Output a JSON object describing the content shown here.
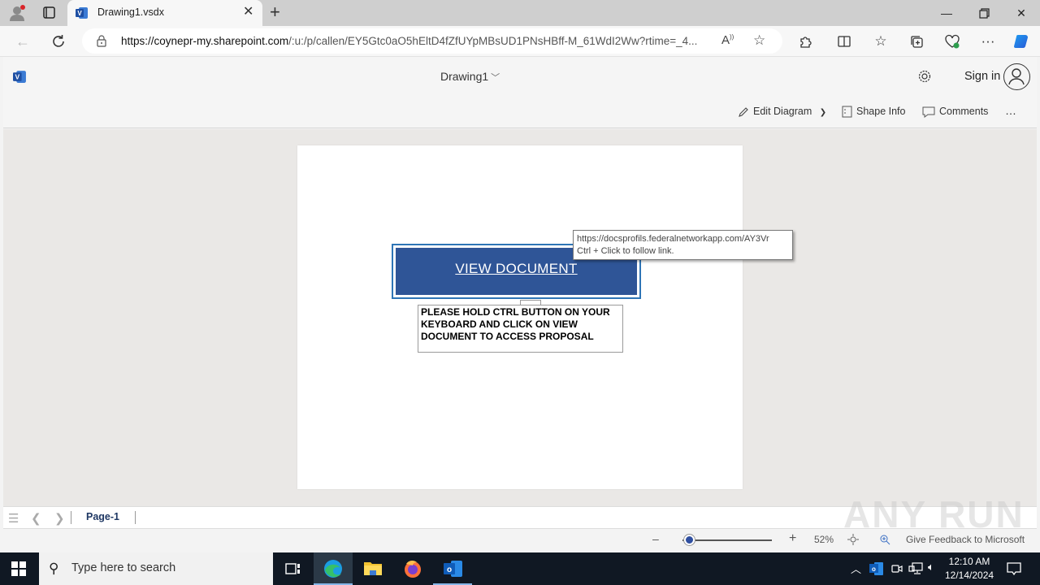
{
  "browser": {
    "tab_title": "Drawing1.vsdx",
    "new_tab_icon": "plus-icon",
    "url_domain": "https://coynepr-my.sharepoint.com",
    "url_rest": "/:u:/p/callen/EY5Gtc0aO5hEltD4fZfUYpMBsUD1PNsHBff-M_61WdI2Ww?rtime=_4...",
    "read_aloud_label": "A",
    "window_controls": [
      "minimize",
      "restore",
      "close"
    ]
  },
  "app": {
    "doc_title": "Drawing1",
    "sign_in": "Sign in",
    "commands": {
      "edit_diagram": "Edit Diagram",
      "shape_info": "Shape Info",
      "comments": "Comments",
      "more": "…"
    }
  },
  "canvas": {
    "view_document_label": "VIEW DOCUMENT",
    "instruction_text": "PLEASE HOLD CTRL BUTTON ON YOUR KEYBOARD AND CLICK ON VIEW DOCUMENT TO ACCESS PROPOSAL",
    "tooltip": {
      "url": "https://docsprofils.federalnetworkapp.com/AY3Vr",
      "hint": "Ctrl + Click to follow link."
    },
    "colors": {
      "button_fill": "#2f5597",
      "button_border": "#2e75b6"
    }
  },
  "pagebar": {
    "page_tab": "Page-1"
  },
  "statusbar": {
    "zoom_minus": "–",
    "zoom_plus": "+",
    "zoom_level": "52%",
    "zoom_slider_value": 0.52,
    "feedback": "Give Feedback to Microsoft"
  },
  "watermark": "ANY RUN",
  "taskbar": {
    "search_placeholder": "Type here to search",
    "time": "12:10 AM",
    "date": "12/14/2024"
  }
}
